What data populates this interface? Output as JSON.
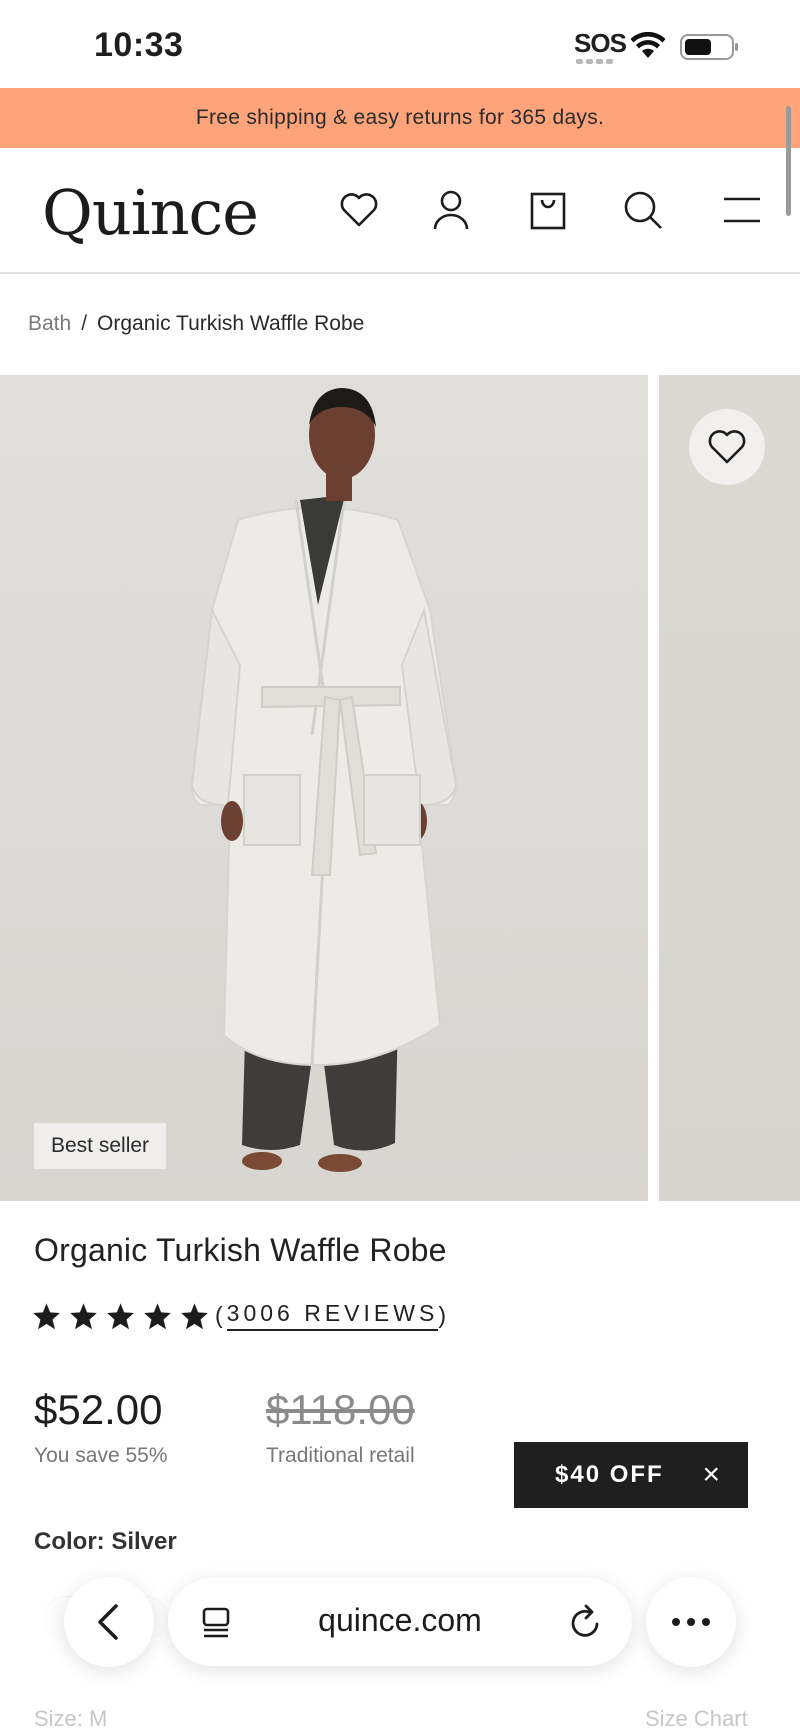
{
  "status_bar": {
    "time": "10:33",
    "sos": "SOS"
  },
  "promo": {
    "text": "Free shipping & easy returns for 365 days."
  },
  "header": {
    "logo": "Quince",
    "icons": [
      "heart-icon",
      "account-icon",
      "shopping-bag-icon",
      "search-icon",
      "menu-icon"
    ]
  },
  "breadcrumb": {
    "parent": "Bath",
    "separator": "/",
    "current": "Organic Turkish Waffle Robe"
  },
  "gallery": {
    "badge": "Best seller"
  },
  "product": {
    "title": "Organic Turkish Waffle Robe",
    "rating": 5,
    "reviews_open": "(",
    "reviews_text": "3006 REVIEWS",
    "reviews_close": ")",
    "price": "$52.00",
    "savings": "You save 55%",
    "retail_price": "$118.00",
    "retail_label": "Traditional retail",
    "color_label": "Color: Silver",
    "size_label": "Size: M",
    "size_chart": "Size Chart"
  },
  "offer": {
    "label": "$40 OFF",
    "close": "×"
  },
  "browser": {
    "url": "quince.com"
  },
  "colors": {
    "promo": "#ffa47a",
    "offer_bg": "#1f1f1f",
    "text": "#1f1f1f"
  }
}
